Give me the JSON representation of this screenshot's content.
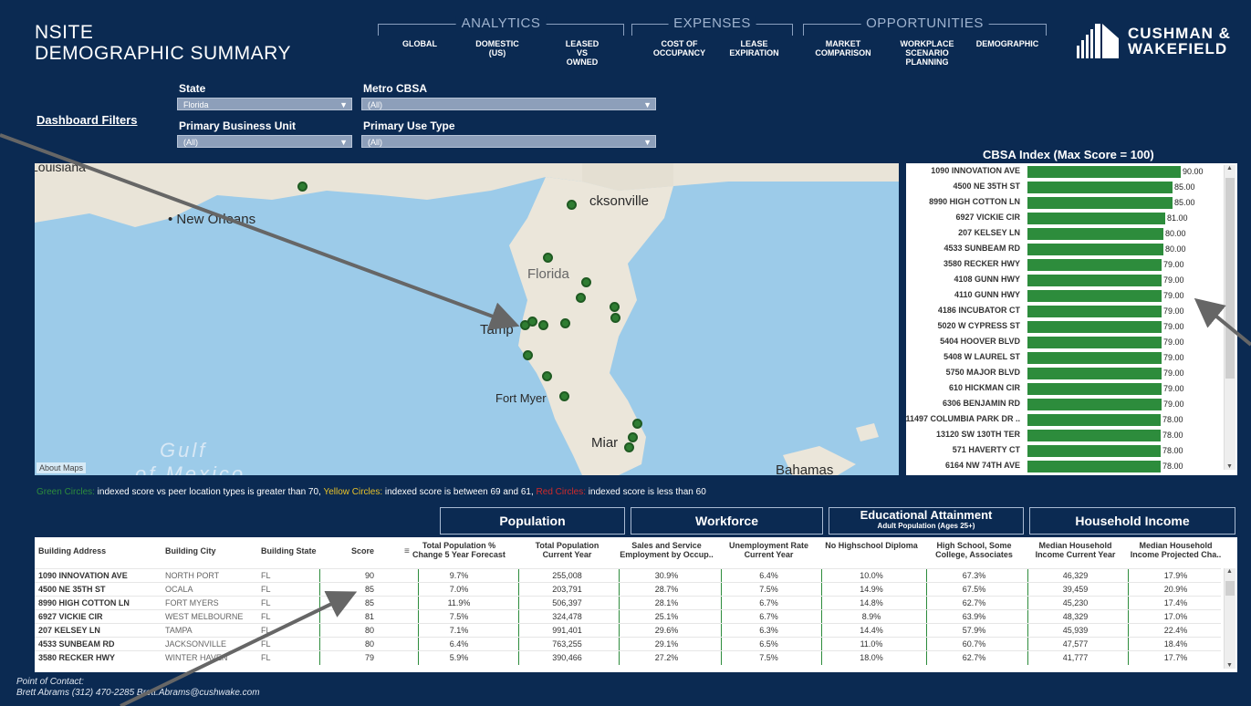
{
  "header": {
    "title_line1": "NSITE",
    "title_line2": "DEMOGRAPHIC SUMMARY",
    "groups": {
      "analytics": "ANALYTICS",
      "expenses": "EXPENSES",
      "opportunities": "OPPORTUNITIES"
    },
    "nav": {
      "global": "GLOBAL",
      "domestic": "DOMESTIC\n(US)",
      "leased": "LEASED\nVS\nOWNED",
      "cost": "COST OF\nOCCUPANCY",
      "lease_exp": "LEASE\nEXPIRATION",
      "market": "MARKET\nCOMPARISON",
      "workplace": "WORKPLACE\nSCENARIO\nPLANNING",
      "demographic": "DEMOGRAPHIC"
    },
    "logo_text": "CUSHMAN &\nWAKEFIELD"
  },
  "filters": {
    "dashboard_label": "Dashboard Filters",
    "state_label": "State",
    "state_value": "Florida",
    "metro_label": "Metro CBSA",
    "metro_value": "(All)",
    "pbu_label": "Primary Business Unit",
    "pbu_value": "(All)",
    "use_label": "Primary Use Type",
    "use_value": "(All)"
  },
  "map": {
    "labels": {
      "louisiana": "Louisiana",
      "new_orleans": "New Orleans",
      "jacksonville": "cksonville",
      "florida": "Florida",
      "tampa": "Tamp",
      "fort_myers": "Fort Myer",
      "miami": "Miar",
      "gulf": "Gulf",
      "mexico": "of Mexico",
      "bahamas": "Bahamas"
    },
    "about": "About Maps"
  },
  "cbsa": {
    "title": "CBSA Index (Max Score = 100)",
    "rows": [
      {
        "name": "1090 INNOVATION AVE",
        "value": 90.0,
        "label": "90.00"
      },
      {
        "name": "4500 NE 35TH ST",
        "value": 85.0,
        "label": "85.00"
      },
      {
        "name": "8990 HIGH COTTON LN",
        "value": 85.0,
        "label": "85.00"
      },
      {
        "name": "6927 VICKIE CIR",
        "value": 81.0,
        "label": "81.00"
      },
      {
        "name": "207 KELSEY LN",
        "value": 80.0,
        "label": "80.00"
      },
      {
        "name": "4533 SUNBEAM RD",
        "value": 80.0,
        "label": "80.00"
      },
      {
        "name": "3580 RECKER HWY",
        "value": 79.0,
        "label": "79.00"
      },
      {
        "name": "4108 GUNN HWY",
        "value": 79.0,
        "label": "79.00"
      },
      {
        "name": "4110 GUNN HWY",
        "value": 79.0,
        "label": "79.00"
      },
      {
        "name": "4186 INCUBATOR CT",
        "value": 79.0,
        "label": "79.00"
      },
      {
        "name": "5020 W CYPRESS ST",
        "value": 79.0,
        "label": "79.00"
      },
      {
        "name": "5404 HOOVER BLVD",
        "value": 79.0,
        "label": "79.00"
      },
      {
        "name": "5408 W LAUREL ST",
        "value": 79.0,
        "label": "79.00"
      },
      {
        "name": "5750 MAJOR BLVD",
        "value": 79.0,
        "label": "79.00"
      },
      {
        "name": "610 HICKMAN CIR",
        "value": 79.0,
        "label": "79.00"
      },
      {
        "name": "6306 BENJAMIN RD",
        "value": 79.0,
        "label": "79.00"
      },
      {
        "name": "11497 COLUMBIA PARK DR ..",
        "value": 78.0,
        "label": "78.00"
      },
      {
        "name": "13120 SW 130TH TER",
        "value": 78.0,
        "label": "78.00"
      },
      {
        "name": "571 HAVERTY CT",
        "value": 78.0,
        "label": "78.00"
      },
      {
        "name": "6164 NW 74TH AVE",
        "value": 78.0,
        "label": "78.00"
      }
    ]
  },
  "legend": {
    "green": "Green Circles:",
    "green_text": " indexed score vs peer location types is greater than 70, ",
    "yellow": "Yellow Circles:",
    "yellow_text": " indexed score is between 69 and 61, ",
    "red": "Red Circles:",
    "red_text": " indexed score is less than 60",
    "colors": {
      "green": "#2d8c3c",
      "yellow": "#e8c22a",
      "red": "#d02b2b"
    }
  },
  "table": {
    "groups": {
      "population": "Population",
      "workforce": "Workforce",
      "education": "Educational Attainment",
      "education_sub": "Adult Population (Ages 25+)",
      "income": "Household Income"
    },
    "columns": [
      "Building Address",
      "Building City",
      "Building State",
      "Score",
      "Total Population %\nChange 5 Year Forecast",
      "Total Population\nCurrent Year",
      "Sales and Service\nEmployment by Occup..",
      "Unemployment Rate\nCurrent Year",
      "No Highschool Diploma",
      "High School, Some\nCollege, Associates",
      "Median Household\nIncome Current Year",
      "Median Household\nIncome Projected Cha.."
    ],
    "rows": [
      [
        "1090 INNOVATION AVE",
        "NORTH PORT",
        "FL",
        "90",
        "9.7%",
        "255,008",
        "30.9%",
        "6.4%",
        "10.0%",
        "67.3%",
        "46,329",
        "17.9%"
      ],
      [
        "4500 NE 35TH ST",
        "OCALA",
        "FL",
        "85",
        "7.0%",
        "203,791",
        "28.7%",
        "7.5%",
        "14.9%",
        "67.5%",
        "39,459",
        "20.9%"
      ],
      [
        "8990 HIGH COTTON LN",
        "FORT MYERS",
        "FL",
        "85",
        "11.9%",
        "506,397",
        "28.1%",
        "6.7%",
        "14.8%",
        "62.7%",
        "45,230",
        "17.4%"
      ],
      [
        "6927 VICKIE CIR",
        "WEST MELBOURNE",
        "FL",
        "81",
        "7.5%",
        "324,478",
        "25.1%",
        "6.7%",
        "8.9%",
        "63.9%",
        "48,329",
        "17.0%"
      ],
      [
        "207 KELSEY LN",
        "TAMPA",
        "FL",
        "80",
        "7.1%",
        "991,401",
        "29.6%",
        "6.3%",
        "14.4%",
        "57.9%",
        "45,939",
        "22.4%"
      ],
      [
        "4533 SUNBEAM RD",
        "JACKSONVILLE",
        "FL",
        "80",
        "6.4%",
        "763,255",
        "29.1%",
        "6.5%",
        "11.0%",
        "60.7%",
        "47,577",
        "18.4%"
      ],
      [
        "3580 RECKER HWY",
        "WINTER HAVEN",
        "FL",
        "79",
        "5.9%",
        "390,466",
        "27.2%",
        "7.5%",
        "18.0%",
        "62.7%",
        "41,777",
        "17.7%"
      ]
    ]
  },
  "footer": {
    "line1": "Point of Contact:",
    "line2": "Brett Abrams (312) 470-2285 Brett.Abrams@cushwake.com"
  }
}
